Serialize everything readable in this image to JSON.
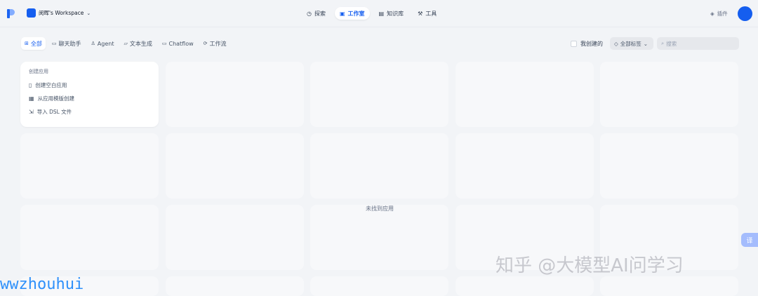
{
  "header": {
    "workspace_name": "闵晖's Workspace",
    "nav": [
      {
        "label": "探索",
        "icon": "explore-icon",
        "active": false
      },
      {
        "label": "工作室",
        "icon": "robot-icon",
        "active": true
      },
      {
        "label": "知识库",
        "icon": "book-icon",
        "active": false
      },
      {
        "label": "工具",
        "icon": "hammer-icon",
        "active": false
      }
    ],
    "plugins_label": "插件"
  },
  "filters": {
    "tabs": [
      {
        "label": "全部",
        "active": true
      },
      {
        "label": "聊天助手",
        "active": false
      },
      {
        "label": "Agent",
        "active": false
      },
      {
        "label": "文本生成",
        "active": false
      },
      {
        "label": "Chatflow",
        "active": false
      },
      {
        "label": "工作流",
        "active": false
      }
    ],
    "mine_label": "我创建的",
    "tags_label": "全部标签",
    "search_placeholder": "搜索"
  },
  "create_card": {
    "title": "创建应用",
    "items": [
      {
        "label": "创建空白应用",
        "icon": "file-blank-icon"
      },
      {
        "label": "从应用模版创建",
        "icon": "template-icon"
      },
      {
        "label": "导入 DSL 文件",
        "icon": "import-icon"
      }
    ]
  },
  "empty_text": "未找到应用",
  "translate_label": "译",
  "watermarks": {
    "left": "wwzhouhui",
    "right": "知乎 @大模型AI问学习"
  },
  "colors": {
    "primary": "#155eef",
    "background": "#f2f4f7",
    "placeholder_card": "#f7f8fa"
  }
}
